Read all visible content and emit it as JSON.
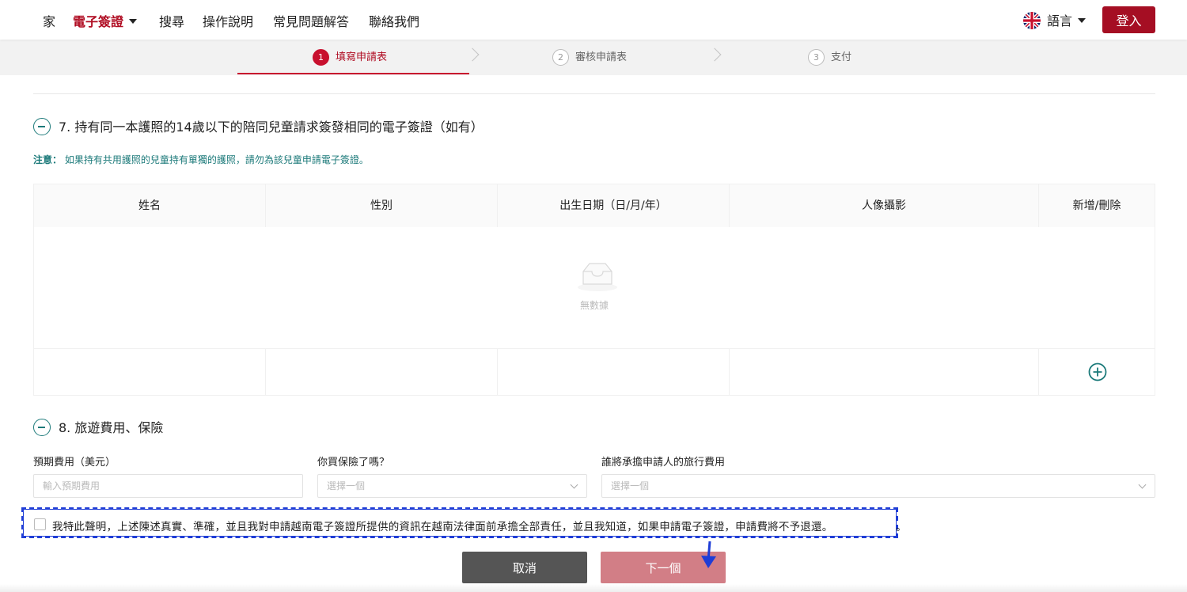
{
  "nav": {
    "home": "家",
    "evisa": "電子簽證",
    "search": "搜尋",
    "guide": "操作說明",
    "faq": "常見問題解答",
    "contact": "聯絡我們",
    "language": "語言",
    "login": "登入"
  },
  "steps": [
    {
      "num": "1",
      "label": "填寫申請表"
    },
    {
      "num": "2",
      "label": "審核申請表"
    },
    {
      "num": "3",
      "label": "支付"
    }
  ],
  "section7": {
    "title": "7. 持有同一本護照的14歲以下的陪同兒童請求簽發相同的電子簽證（如有）",
    "note_label": "注意：",
    "note_text": "如果持有共用護照的兒童持有單獨的護照，請勿為該兒童申請電子簽證。",
    "columns": [
      "姓名",
      "性別",
      "出生日期（日/月/年）",
      "人像攝影",
      "新增/刪除"
    ],
    "empty_text": "無數據"
  },
  "section8": {
    "title": "8. 旅遊費用、保險",
    "expected_cost_label": "預期費用（美元）",
    "expected_cost_placeholder": "輸入預期費用",
    "insurance_label": "你買保險了嗎？",
    "insurance_placeholder": "選擇一個",
    "payer_label": "誰將承擔申請人的旅行費用",
    "payer_placeholder": "選擇一個"
  },
  "declaration": {
    "text": "我特此聲明，上述陳述真實、準確，並且我對申請越南電子簽證所提供的資訊在越南法律面前承擔全部責任，並且我知道，如果申請電子簽證，申請費將不予退還。",
    "tail": "。"
  },
  "actions": {
    "cancel": "取消",
    "next": "下一個"
  },
  "colors": {
    "brand_red": "#a50e23",
    "teal": "#1c7a7a",
    "highlight_blue": "#1f3dd6"
  }
}
